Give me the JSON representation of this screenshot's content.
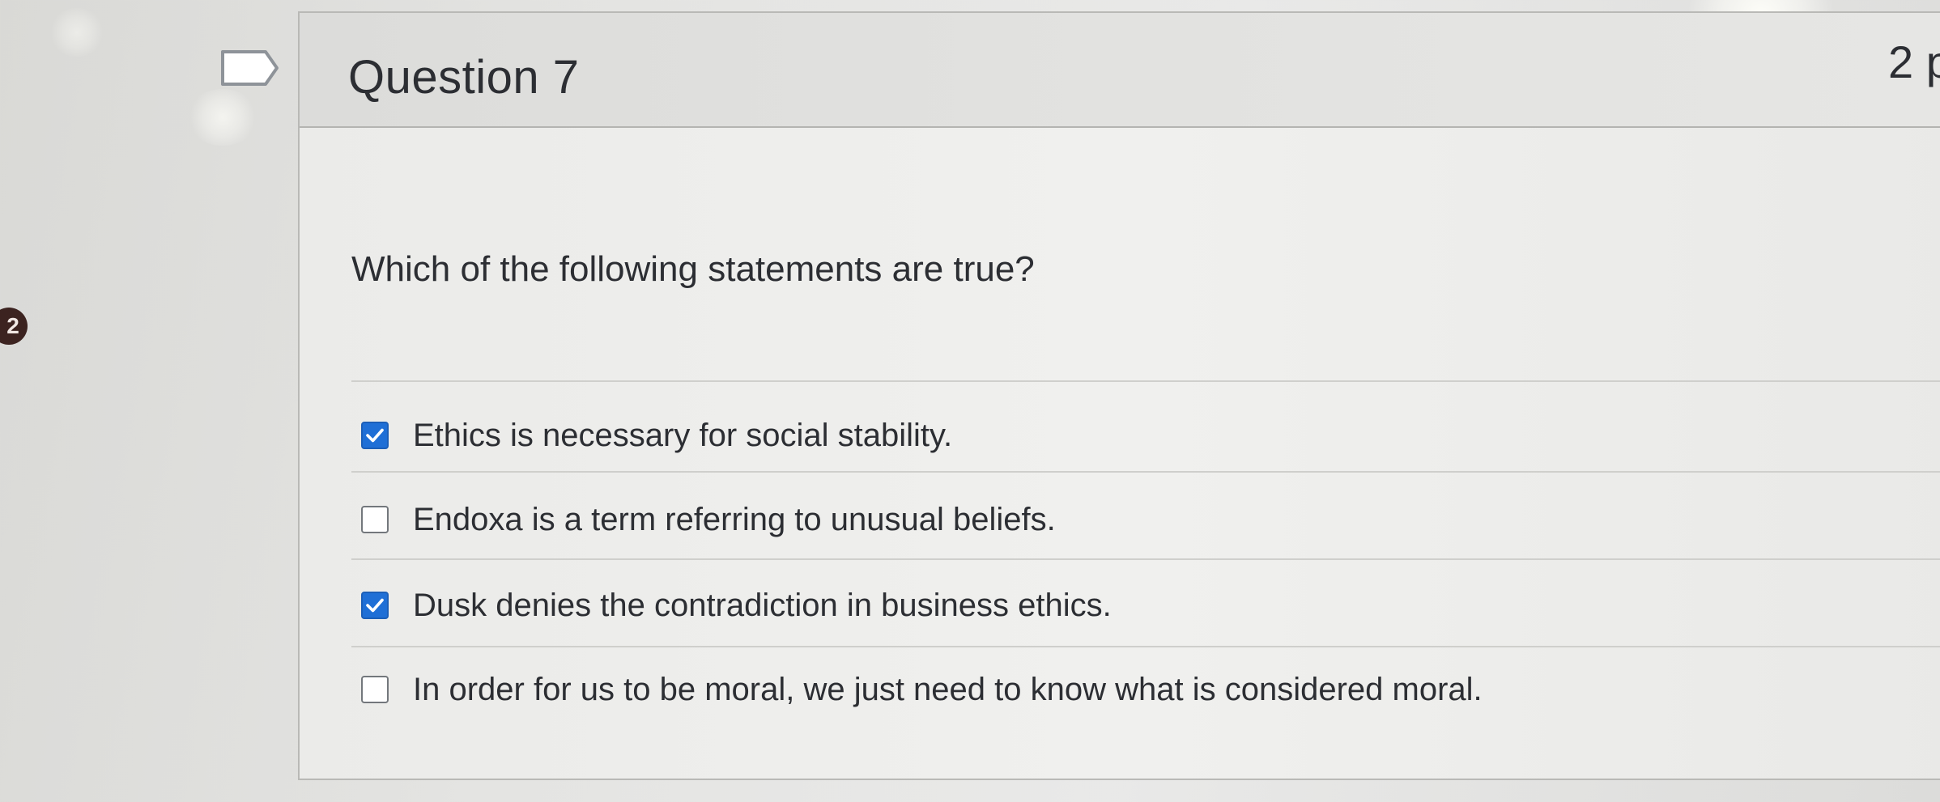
{
  "question": {
    "title": "Question 7",
    "points": "2 p",
    "prompt": "Which of the following statements are true?",
    "flag_icon": "flag-outline-icon"
  },
  "side_badge": {
    "value": "2"
  },
  "answers": [
    {
      "label": "Ethics is necessary for social stability.",
      "checked": true
    },
    {
      "label": "Endoxa is a term referring to unusual beliefs.",
      "checked": false
    },
    {
      "label": "Dusk denies the contradiction in business ethics.",
      "checked": true
    },
    {
      "label": "In order for us to be moral, we just need to know what is considered moral.",
      "checked": false
    }
  ],
  "colors": {
    "checkbox_checked": "#1f6fd6",
    "text": "#2c2e33",
    "card_border": "#b9b9b6"
  }
}
